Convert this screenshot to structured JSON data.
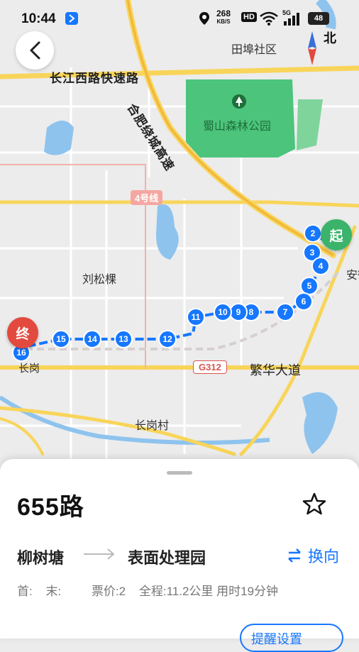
{
  "status_bar": {
    "time": "10:44",
    "net_speed_top": "268",
    "net_speed_unit": "KB/S",
    "hd_badge": "HD",
    "signal_label": "5G",
    "battery": "48"
  },
  "map": {
    "compass_label": "北",
    "labels": {
      "tianbu": "田埠社区",
      "changjiang": "长江西路快速路",
      "hefei_highway": "合肥绕城高速",
      "shushan_park": "蜀山森林公园",
      "liusongke": "刘松棵",
      "an": "安徽",
      "fanhua": "繁华大道",
      "changgang_cun": "长岗村",
      "changgang": "长岗"
    },
    "g312": "G312",
    "line4": "4号线",
    "stops": [
      "2",
      "3",
      "4",
      "5",
      "6",
      "7",
      "8",
      "9",
      "10",
      "11",
      "12",
      "13",
      "14",
      "15",
      "16"
    ],
    "start_marker": "起",
    "end_marker": "终"
  },
  "colors": {
    "route": "#1677ff",
    "start": "#3bb36b",
    "end": "#e34a3f",
    "park": "#4cc47c",
    "water": "#8ec3ee"
  },
  "route_card": {
    "route_name": "655路",
    "from": "柳树塘",
    "to": "表面处理园",
    "switch_label": "换向",
    "first_label": "首:",
    "last_label": "末:",
    "fare": "票价:2",
    "distance": "全程:11.2公里 用时19分钟",
    "remind_label": "提醒设置"
  }
}
